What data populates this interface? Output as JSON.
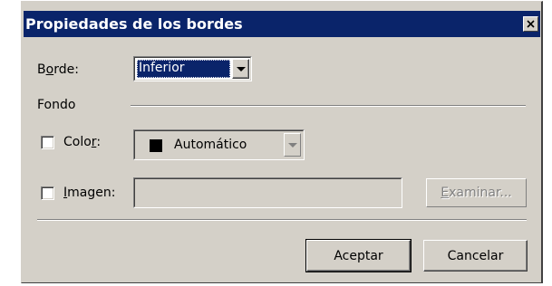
{
  "dialog": {
    "title": "Propiedades de los bordes"
  },
  "border": {
    "label_prefix": "B",
    "label_mnemonic": "o",
    "label_suffix": "rde:",
    "selected": "Inferior"
  },
  "background": {
    "section_label": "Fondo",
    "color": {
      "label_prefix": "Colo",
      "label_mnemonic": "r",
      "label_suffix": ":",
      "checked": false,
      "selected": "Automático",
      "swatch_color": "#000000"
    },
    "image": {
      "label_mnemonic": "I",
      "label_suffix": "magen:",
      "checked": false,
      "value": "",
      "browse_mnemonic": "E",
      "browse_suffix": "xaminar..."
    }
  },
  "buttons": {
    "ok": "Aceptar",
    "cancel": "Cancelar"
  },
  "colors": {
    "titlebar": "#0a246a",
    "face": "#d4d0c8",
    "selection": "#0a246a"
  }
}
